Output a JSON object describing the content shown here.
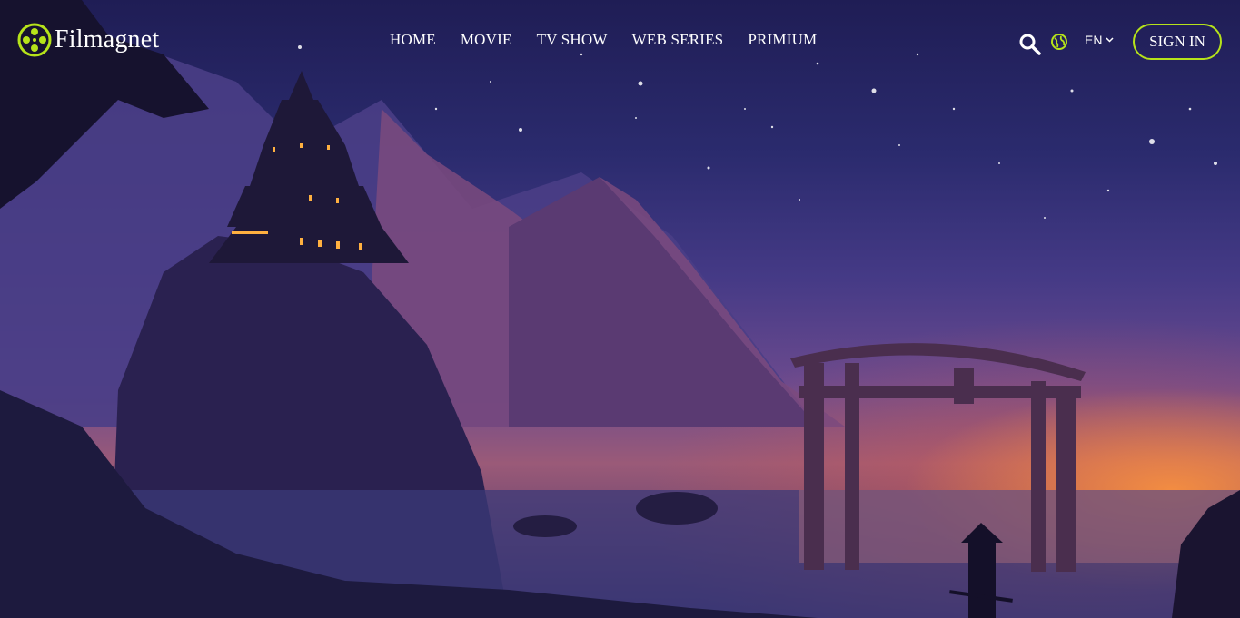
{
  "brand": {
    "name": "Filmagnet",
    "accent": "#b6e31a"
  },
  "nav": {
    "items": [
      {
        "label": "HOME"
      },
      {
        "label": "MOVIE"
      },
      {
        "label": "TV SHOW"
      },
      {
        "label": "WEB SERIES"
      },
      {
        "label": "PRIMIUM"
      }
    ]
  },
  "tools": {
    "search_icon": "search-icon",
    "globe_icon": "globe-icon",
    "language": "EN",
    "signin_label": "SIGN IN"
  }
}
